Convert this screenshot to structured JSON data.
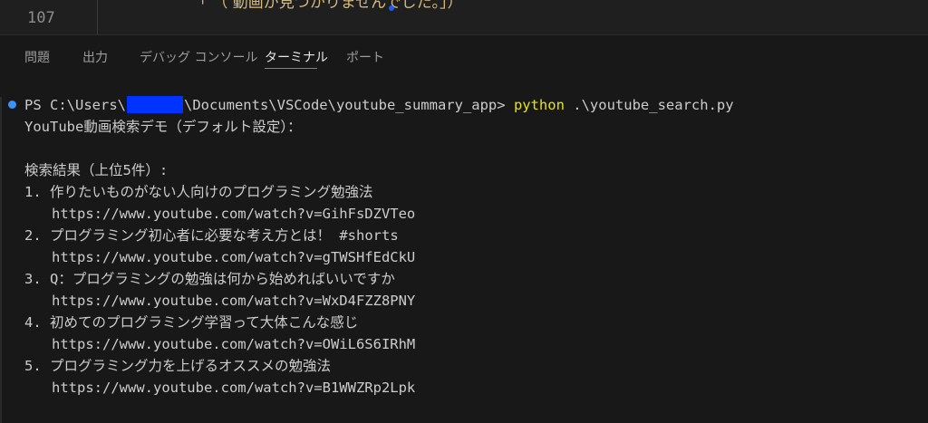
{
  "editor": {
    "line_number": "107",
    "code_fragment": "「 （ 動画が見つかりませんでした。」）"
  },
  "panel": {
    "tabs": [
      {
        "label": "問題"
      },
      {
        "label": "出力"
      },
      {
        "label": "デバッグ コンソール"
      },
      {
        "label": "ターミナル"
      },
      {
        "label": "ポート"
      }
    ],
    "active_tab": "ターミナル"
  },
  "terminal": {
    "prompt_prefix": "PS C:\\Users\\",
    "prompt_suffix": "\\Documents\\VSCode\\youtube_summary_app> ",
    "command": "python",
    "command_args": " .\\youtube_search.py",
    "title_line": "YouTube動画検索デモ（デフォルト設定）：",
    "results_header": "検索結果（上位5件）:",
    "results": [
      {
        "title": "1. 作りたいものがない人向けのプログラミング勉強法",
        "url": "https://www.youtube.com/watch?v=GihFsDZVTeo"
      },
      {
        "title": "2. プログラミング初心者に必要な考え方とは！ #shorts",
        "url": "https://www.youtube.com/watch?v=gTWSHfEdCkU"
      },
      {
        "title": "3. Q：プログラミングの勉強は何から始めればいいですか",
        "url": "https://www.youtube.com/watch?v=WxD4FZZ8PNY"
      },
      {
        "title": "4. 初めてのプログラミング学習って大体こんな感じ",
        "url": "https://www.youtube.com/watch?v=OWiL6S6IRhM"
      },
      {
        "title": "5. プログラミング力を上げるオススメの勉強法",
        "url": "https://www.youtube.com/watch?v=B1WWZRp2Lpk"
      }
    ]
  },
  "colors": {
    "background": "#181818",
    "accent": "#3794ff",
    "command": "#e5e510",
    "redaction": "#0033ff"
  }
}
